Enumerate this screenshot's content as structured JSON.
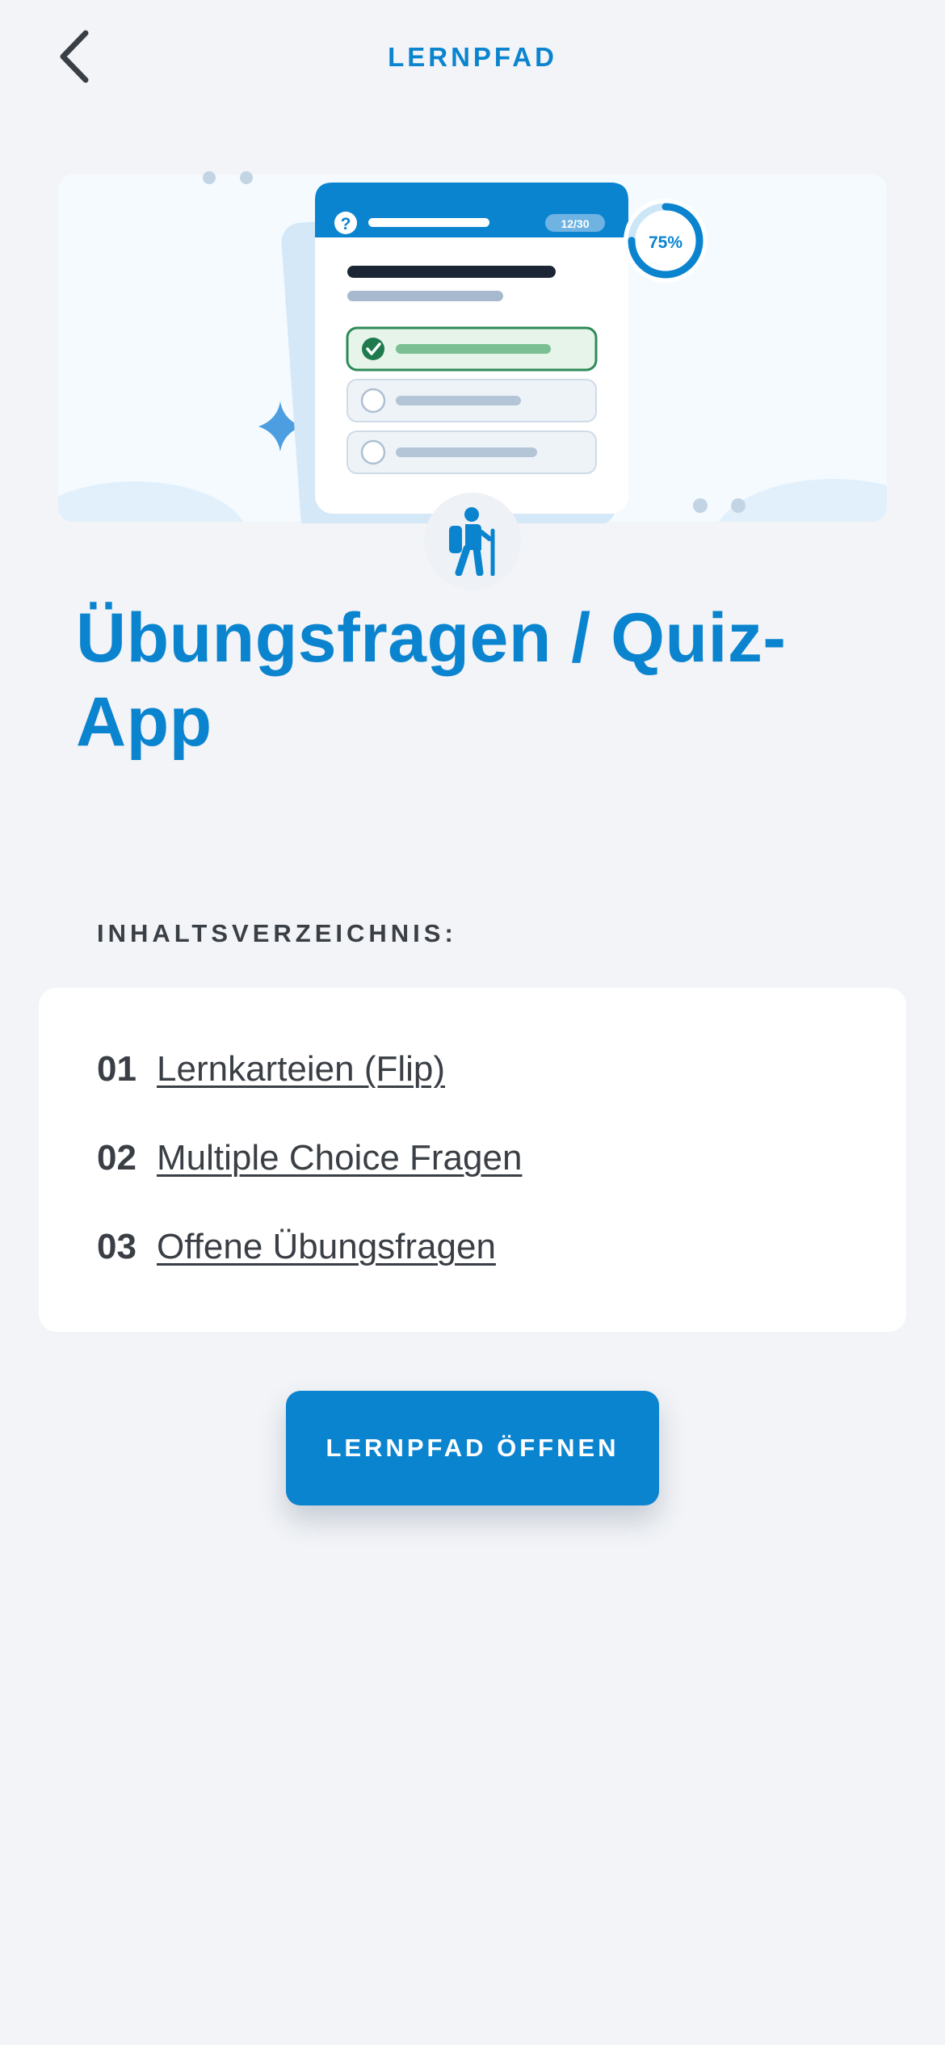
{
  "header": {
    "title": "LERNPFAD",
    "back_icon": "chevron-left-icon"
  },
  "hero": {
    "quiz_counter": "12/30",
    "progress_label": "75%",
    "progress_value": 0.75,
    "question_mark": "?",
    "badge_icon": "hiker-icon"
  },
  "page": {
    "title": "Übungsfragen / Quiz-App"
  },
  "toc": {
    "heading": "INHALTSVERZEICHNIS:",
    "items": [
      {
        "number": "01",
        "label": "Lernkarteien (Flip)"
      },
      {
        "number": "02",
        "label": "Multiple Choice Fragen"
      },
      {
        "number": "03",
        "label": "Offene Übungsfragen"
      }
    ]
  },
  "cta": {
    "label": "LERNPFAD ÖFFNEN"
  },
  "colors": {
    "accent": "#0b84cf",
    "background": "#f2f4f7",
    "text": "#3a3f45",
    "success": "#1f7a4d"
  }
}
